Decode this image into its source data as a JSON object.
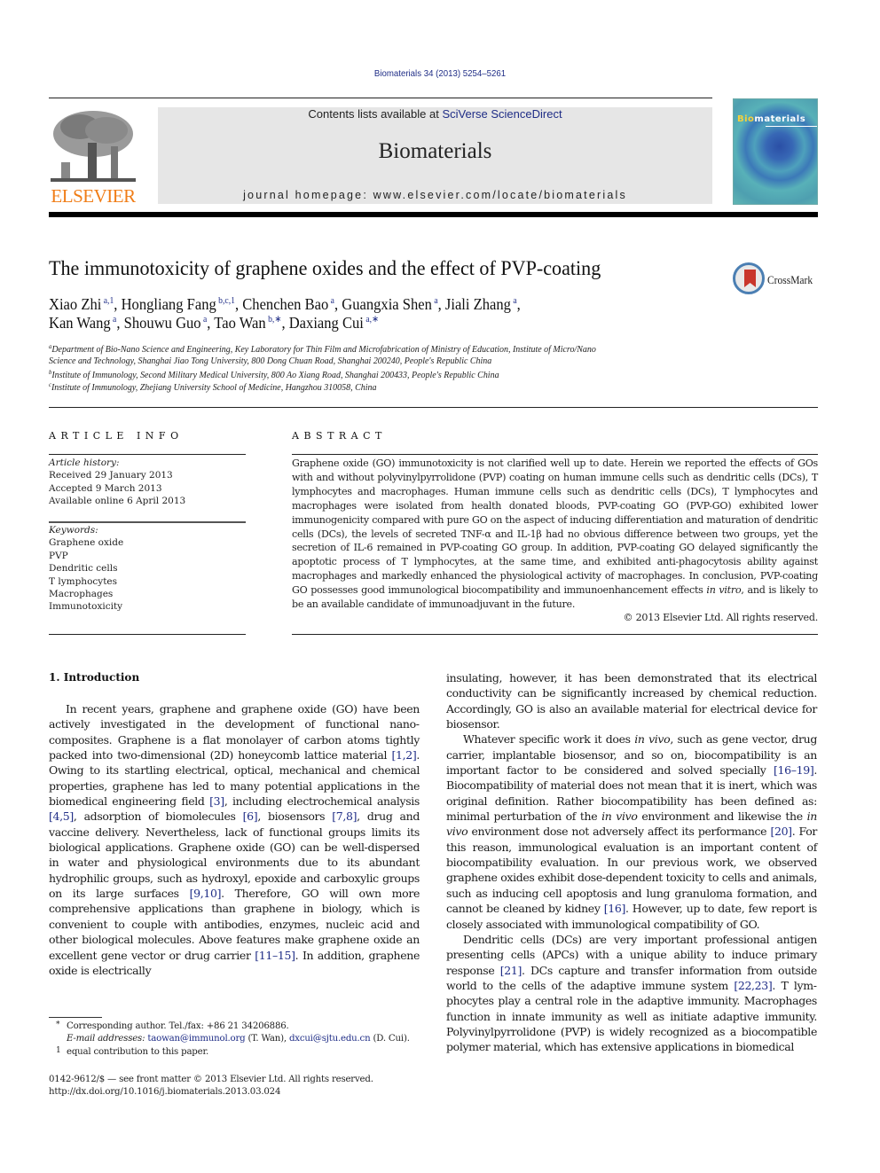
{
  "header": {
    "journal_ref": "Biomaterials 34 (2013) 5254–5261",
    "contents_prefix": "Contents lists available at ",
    "contents_link": "SciVerse ScienceDirect",
    "journal_name": "Biomaterials",
    "homepage": "journal homepage: www.elsevier.com/locate/biomaterials",
    "publisher_logo": "ELSEVIER",
    "cover_title_accent": "Bio",
    "cover_title_rest": "materials",
    "accent_color": "#f07d17",
    "link_color": "#1f2d86"
  },
  "article": {
    "title": "The immunotoxicity of graphene oxides and the effect of PVP-coating",
    "crossmark_label": "CrossMark",
    "authors_line1": [
      {
        "name": "Xiao Zhi",
        "sup": "a,1",
        "sep": ", "
      },
      {
        "name": "Hongliang Fang",
        "sup": "b,c,1",
        "sep": ", "
      },
      {
        "name": "Chenchen Bao",
        "sup": "a",
        "sep": ", "
      },
      {
        "name": "Guangxia Shen",
        "sup": "a",
        "sep": ", "
      },
      {
        "name": "Jiali Zhang",
        "sup": "a",
        "sep": ","
      }
    ],
    "authors_line2": [
      {
        "name": "Kan Wang",
        "sup": "a",
        "sep": ", "
      },
      {
        "name": "Shouwu Guo",
        "sup": "a",
        "sep": ", "
      },
      {
        "name": "Tao Wan",
        "sup": "b,∗",
        "sep": ", "
      },
      {
        "name": "Daxiang Cui",
        "sup": "a,∗",
        "sep": ""
      }
    ],
    "affiliations": {
      "a_mark": "a",
      "a_line1": "Department of Bio-Nano Science and Engineering, Key Laboratory for Thin Film and Microfabrication of Ministry of Education, Institute of Micro/Nano",
      "a_line2": "Science and Technology, Shanghai Jiao Tong University, 800 Dong Chuan Road, Shanghai 200240, People's Republic China",
      "b_mark": "b",
      "b": "Institute of Immunology, Second Military Medical University, 800 Ao Xiang Road, Shanghai 200433, People's Republic China",
      "c_mark": "c",
      "c": "Institute of Immunology, Zhejiang University School of Medicine, Hangzhou 310058, China"
    }
  },
  "article_info": {
    "heading": "ARTICLE INFO",
    "history_label": "Article history:",
    "history": [
      "Received 29 January 2013",
      "Accepted 9 March 2013",
      "Available online 6 April 2013"
    ],
    "keywords_label": "Keywords:",
    "keywords": [
      "Graphene oxide",
      "PVP",
      "Dendritic cells",
      "T lymphocytes",
      "Macrophages",
      "Immunotoxicity"
    ]
  },
  "abstract": {
    "heading": "ABSTRACT",
    "text_before_italic": "Graphene oxide (GO) immunotoxicity is not clarified well up to date. Herein we reported the effects of GOs with and without polyvinylpyrrolidone (PVP) coating on human immune cells such as dendritic cells (DCs), T lymphocytes and macrophages. Human immune cells such as dendritic cells (DCs), T lympho­cytes and macrophages were isolated from health donated bloods, PVP-coating GO (PVP-GO) exhibited lower immunogenicity compared with pure GO on the aspect of inducing differentiation and maturation of dendritic cells (DCs), the levels of secreted TNF-α and IL-1β had no obvious difference between two groups, yet the secretion of IL-6 remained in PVP-coating GO group. In addition, PVP-coating GO delayed significantly the apoptotic process of T lymphocytes, at the same time, and exhibited anti-phagocytosis ability against macrophages and markedly enhanced the physiological activity of macrophages. In conclusion, PVP-coating GO possesses good immunological biocompatibility and immunoenhancement effects ",
    "italic": "in vitro",
    "text_after_italic": ", and is likely to be an available candidate of immunoadjuvant in the future.",
    "copyright": "© 2013 Elsevier Ltd. All rights reserved."
  },
  "introduction": {
    "heading": "1.  Introduction",
    "left_column": [
      {
        "t": "In recent years, graphene and graphene oxide (GO) have been actively investigated in the development of functional nano­composites. Graphene is a flat monolayer of carbon atoms tightly packed into two-dimensional (2D) honeycomb lattice material "
      },
      {
        "r": "[1,2]"
      },
      {
        "t": ". Owing to its startling electrical, optical, mechanical and chemical properties, graphene has led to many potential appli­cations in the biomedical engineering field "
      },
      {
        "r": "[3]"
      },
      {
        "t": ", including elec­trochemical analysis "
      },
      {
        "r": "[4,5]"
      },
      {
        "t": ", adsorption of biomolecules "
      },
      {
        "r": "[6]"
      },
      {
        "t": ", biosensors "
      },
      {
        "r": "[7,8]"
      },
      {
        "t": ", drug and vaccine delivery. Nevertheless, lack of functional groups limits its biological applications. Graphene oxide (GO) can be well-dispersed in water and physiological environments due to its abundant hydrophilic groups, such as hydroxyl, epoxide and carboxylic groups on its large surfaces "
      },
      {
        "r": "[9,10]"
      },
      {
        "t": ". Therefore, GO will own more comprehensive applications than graphene in biology, which is convenient to couple with antibodies, enzymes, nucleic acid and other biological molecules. Above features make graphene oxide an excellent gene vector or drug carrier "
      },
      {
        "r": "[11–15]"
      },
      {
        "t": ". In addition, graphene oxide is electrically"
      }
    ],
    "right_p1": "insulating, however, it has been demonstrated that its electrical conductivity can be significantly increased by chemical reduction. Accordingly, GO is also an available material for electrical device for biosensor.",
    "right_p2": [
      {
        "t": "Whatever specific work it does "
      },
      {
        "i": "in vivo"
      },
      {
        "t": ", such as gene vector, drug carrier, implantable biosensor, and so on, biocompatibility is an important factor to be considered and solved specially "
      },
      {
        "r": "[16–19]"
      },
      {
        "t": ". Biocompatibility of material does not mean that it is inert, which was original definition. Rather biocompatibility has been defined as: minimal perturbation of the "
      },
      {
        "i": "in vivo"
      },
      {
        "t": " environment and likewise the "
      },
      {
        "i": "in vivo"
      },
      {
        "t": " environment dose not adversely affect its performance "
      },
      {
        "r": "[20]"
      },
      {
        "t": ". For this reason, immunological evaluation is an important content of biocompatibility evaluation. In our previous work, we observed graphene oxides exhibit dose-dependent toxicity to cells and ani­mals, such as inducing cell apoptosis and lung granuloma formation, and cannot be cleaned by kidney "
      },
      {
        "r": "[16]"
      },
      {
        "t": ". However, up to date, few report is closely associated with immunological compatibility of GO."
      }
    ],
    "right_p3": [
      {
        "t": "Dendritic cells (DCs) are very important professional antigen presenting cells (APCs) with a unique ability to induce primary response "
      },
      {
        "r": "[21]"
      },
      {
        "t": ". DCs capture and transfer information from outside world to the cells of the adaptive immune system "
      },
      {
        "r": "[22,23]"
      },
      {
        "t": ". T lym­phocytes play a central role in the adaptive immunity. Macrophages function in innate immunity as well as initiate adaptive immunity. Polyvinylpyrrolidone (PVP) is widely recognized as a biocompatible polymer material, which has extensive applications in biomedical"
      }
    ]
  },
  "footnotes": {
    "star_mark": "*",
    "corresponding": "Corresponding author. Tel./fax: +86 21 34206886.",
    "email_label": "E-mail addresses:",
    "email1": "taowan@immunol.org",
    "email1_who": " (T. Wan), ",
    "email2": "dxcui@sjtu.edu.cn",
    "email2_who": " (D. Cui).",
    "one_mark": "1",
    "equal": "equal contribution to this paper.",
    "front_matter": "0142-9612/$ — see front matter © 2013 Elsevier Ltd. All rights reserved.",
    "doi": "http://dx.doi.org/10.1016/j.biomaterials.2013.03.024"
  }
}
